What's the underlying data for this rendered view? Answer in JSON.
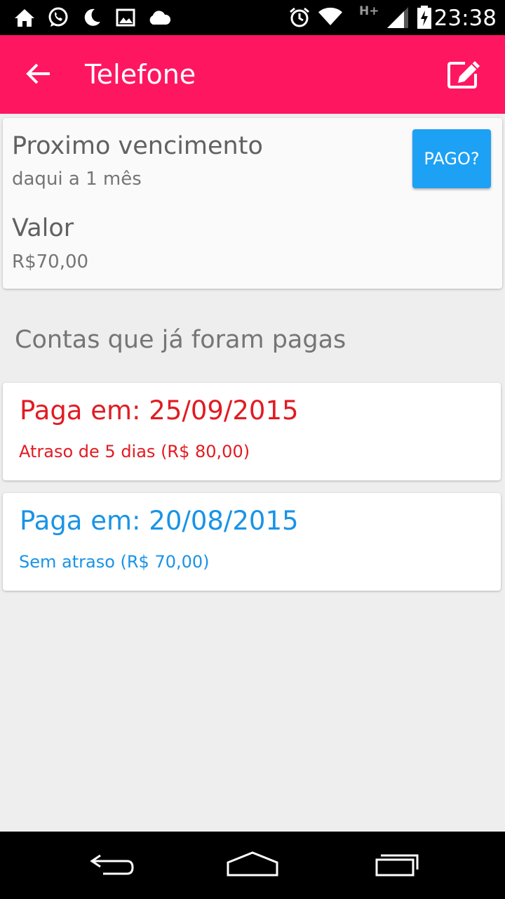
{
  "status_bar": {
    "time": "23:38",
    "network": "H+",
    "icons": [
      "home-icon",
      "whatsapp-icon",
      "moon-icon",
      "image-icon",
      "cloud-icon",
      "alarm-icon",
      "wifi-icon",
      "signal-icon",
      "battery-charging-icon"
    ]
  },
  "app_bar": {
    "title": "Telefone",
    "back_icon": "arrow-back-icon",
    "edit_icon": "edit-icon",
    "color": "#ff1661"
  },
  "summary": {
    "due_label": "Proximo vencimento",
    "due_value": "daqui a 1 mês",
    "value_label": "Valor",
    "value_value": "R$70,00",
    "paid_button": "PAGO?",
    "paid_button_color": "#1da1f5"
  },
  "history": {
    "title": "Contas que já foram pagas",
    "items": [
      {
        "date_line": "Paga em: 25/09/2015",
        "detail_line": "Atraso de 5 dias (R$ 80,00)",
        "color": "#e11b22"
      },
      {
        "date_line": "Paga em: 20/08/2015",
        "detail_line": "Sem atraso (R$ 70,00)",
        "color": "#1993e6"
      }
    ]
  },
  "nav_bar": {
    "icons": [
      "back-nav-icon",
      "home-nav-icon",
      "recents-nav-icon"
    ]
  }
}
